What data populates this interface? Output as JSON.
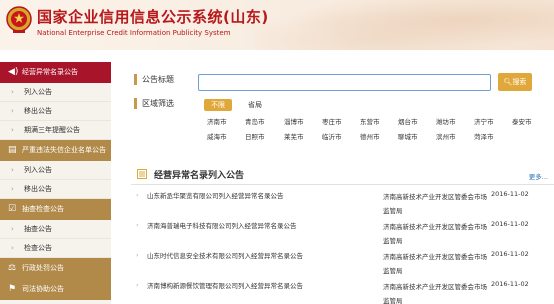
{
  "header": {
    "title": "国家企业信用信息公示系统(山东)",
    "subtitle": "National Enterprise Credit Information Publicity System"
  },
  "sidebar": {
    "sections": [
      {
        "label": "经营异常名录公告",
        "icon": "speaker-icon",
        "style": "red",
        "items": [
          "列入公告",
          "移出公告",
          "期满三年提醒公告"
        ]
      },
      {
        "label": "严重违法失信企业名单公告",
        "icon": "list-icon",
        "style": "gold",
        "items": [
          "列入公告",
          "移出公告"
        ]
      },
      {
        "label": "抽查检查公告",
        "icon": "check-icon",
        "style": "gold",
        "items": [
          "抽查公告",
          "检查公告"
        ]
      },
      {
        "label": "行政处罚公告",
        "icon": "gavel-icon",
        "style": "gold",
        "items": []
      },
      {
        "label": "司法协助公告",
        "icon": "scale-icon",
        "style": "gold",
        "items": []
      }
    ]
  },
  "search": {
    "title_label": "公告标题",
    "input_value": "",
    "input_placeholder": "",
    "button_label": "搜索",
    "region_label": "区域筛选",
    "filter_all": "不限",
    "filter_province": "省局",
    "cities_row1": [
      "济南市",
      "青岛市",
      "淄博市",
      "枣庄市",
      "东营市",
      "烟台市",
      "潍坊市",
      "济宁市",
      "泰安市"
    ],
    "cities_row2": [
      "威海市",
      "日照市",
      "莱芜市",
      "临沂市",
      "德州市",
      "聊城市",
      "滨州市",
      "菏泽市"
    ]
  },
  "list": {
    "title": "经营异常名录列入公告",
    "more_label": "更多...",
    "rows": [
      {
        "title": "山东新丞华聚览有限公司列入经营异常名录公告",
        "authority": "济南高新技术产业开发区管委会市场监管局",
        "date": "2016-11-02"
      },
      {
        "title": "济南海普瑞电子科技有限公司列入经营异常名录公告",
        "authority": "济南高新技术产业开发区管委会市场监管局",
        "date": "2016-11-02"
      },
      {
        "title": "山东时代信息安全技术有限公司列入经营异常名录公告",
        "authority": "济南高新技术产业开发区管委会市场监管局",
        "date": "2016-11-02"
      },
      {
        "title": "济南博构新源餐饮管理有限公司列入经营异常名录公告",
        "authority": "济南高新技术产业开发区管委会市场监管局",
        "date": "2016-11-02"
      }
    ]
  },
  "colors": {
    "brand_red": "#b7181c",
    "sidebar_red": "#a8152a",
    "sidebar_gold": "#b18a4a",
    "accent_orange": "#e0a83b",
    "link_blue": "#2a6fb8"
  }
}
